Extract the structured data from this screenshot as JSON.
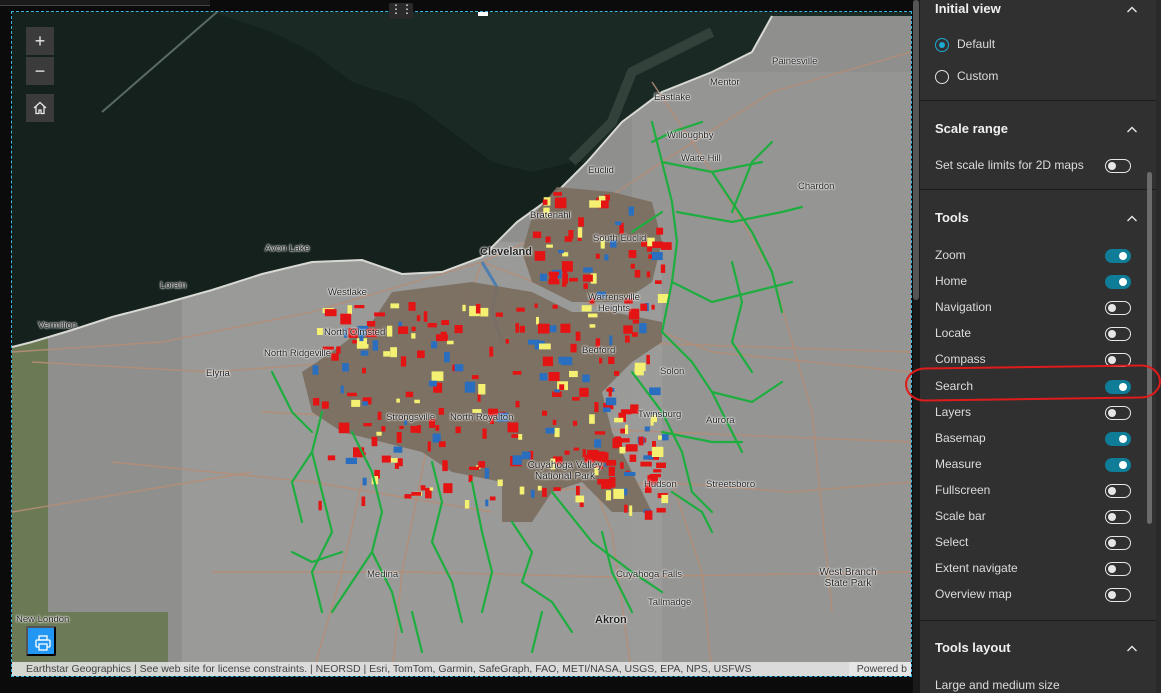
{
  "map": {
    "zoom_in": "+",
    "zoom_out": "−",
    "drag_handle": "⋮⋮",
    "attribution": "Earthstar Geographics | See web site for license constraints. | NEORSD | Esri, TomTom, Garmin, SafeGraph, FAO, METI/NASA, USGS, EPA, NPS, USFWS",
    "powered": "Powered b",
    "places": [
      {
        "name": "Painesville"
      },
      {
        "name": "Mentor"
      },
      {
        "name": "Eastlake"
      },
      {
        "name": "Willoughby"
      },
      {
        "name": "Waite Hill"
      },
      {
        "name": "Euclid"
      },
      {
        "name": "Chardon"
      },
      {
        "name": "Bratenahl"
      },
      {
        "name": "South Euclid"
      },
      {
        "name": "Cleveland"
      },
      {
        "name": "Avon Lake"
      },
      {
        "name": "Lorain"
      },
      {
        "name": "Westlake"
      },
      {
        "name": "Warrensville Heights"
      },
      {
        "name": "Vermilion"
      },
      {
        "name": "North Olmsted"
      },
      {
        "name": "North Ridgeville"
      },
      {
        "name": "Bedford"
      },
      {
        "name": "Elyria"
      },
      {
        "name": "Solon"
      },
      {
        "name": "Strongsville"
      },
      {
        "name": "North Royalton"
      },
      {
        "name": "Twinsburg"
      },
      {
        "name": "Aurora"
      },
      {
        "name": "Cuyahoga Valley National Park"
      },
      {
        "name": "Hudson"
      },
      {
        "name": "Streetsboro"
      },
      {
        "name": "Medina"
      },
      {
        "name": "Cuyahoga Falls"
      },
      {
        "name": "West Branch State Park"
      },
      {
        "name": "Tallmadge"
      },
      {
        "name": "New London"
      },
      {
        "name": "Akron"
      }
    ]
  },
  "panel": {
    "initial_view": {
      "title": "Initial view",
      "options": [
        {
          "label": "Default",
          "selected": true
        },
        {
          "label": "Custom",
          "selected": false
        }
      ]
    },
    "scale_range": {
      "title": "Scale range",
      "setting": {
        "label": "Set scale limits for 2D maps",
        "on": false
      }
    },
    "tools": {
      "title": "Tools",
      "items": [
        {
          "label": "Zoom",
          "on": true
        },
        {
          "label": "Home",
          "on": true
        },
        {
          "label": "Navigation",
          "on": false
        },
        {
          "label": "Locate",
          "on": false
        },
        {
          "label": "Compass",
          "on": false
        },
        {
          "label": "Search",
          "on": true
        },
        {
          "label": "Layers",
          "on": false
        },
        {
          "label": "Basemap",
          "on": true
        },
        {
          "label": "Measure",
          "on": true
        },
        {
          "label": "Fullscreen",
          "on": false
        },
        {
          "label": "Scale bar",
          "on": false
        },
        {
          "label": "Select",
          "on": false
        },
        {
          "label": "Extent navigate",
          "on": false
        },
        {
          "label": "Overview map",
          "on": false
        }
      ]
    },
    "tools_layout": {
      "title": "Tools layout",
      "subtitle": "Large and medium size"
    }
  },
  "colors": {
    "accent": "#1eaad2",
    "toggle_on": "#0f7c98",
    "annotation": "#e01b1b",
    "print_button": "#2196f3"
  }
}
